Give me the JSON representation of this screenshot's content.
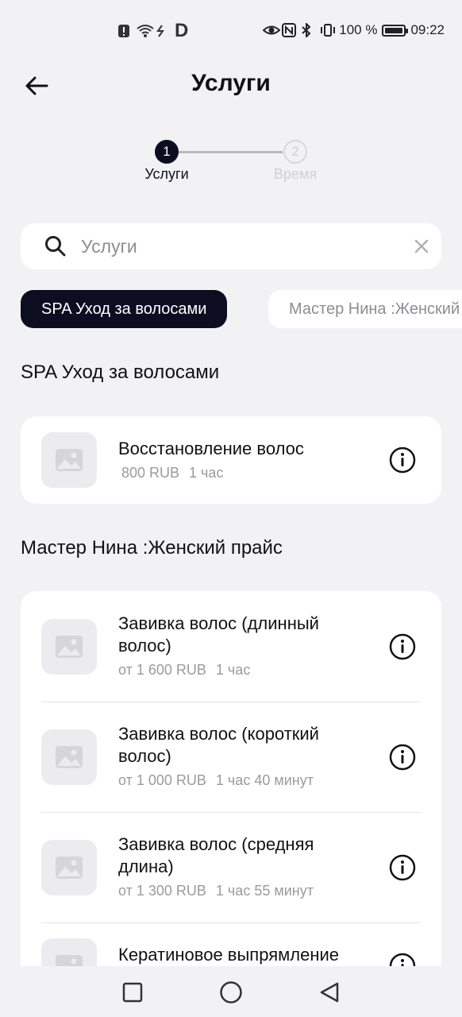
{
  "status_bar": {
    "carrier_glyph": "D",
    "battery": "100 %",
    "time": "09:22"
  },
  "header": {
    "title": "Услуги"
  },
  "stepper": {
    "steps": [
      {
        "number": "1",
        "label": "Услуги"
      },
      {
        "number": "2",
        "label": "Время"
      }
    ]
  },
  "search": {
    "placeholder": "Услуги",
    "value": ""
  },
  "chips": [
    {
      "label": "SPA Уход за волосами"
    },
    {
      "label": "Мастер Нина :Женский прайс"
    }
  ],
  "sections": [
    {
      "title": "SPA Уход за волосами",
      "services": [
        {
          "name": "Восстановление волос",
          "price": "800 RUB",
          "duration": "1 час"
        }
      ]
    },
    {
      "title": "Мастер Нина :Женский прайс",
      "services": [
        {
          "name": "Завивка волос (длинный волос)",
          "price": "от 1 600 RUB",
          "duration": "1 час"
        },
        {
          "name": "Завивка волос (короткий волос)",
          "price": "от 1 000 RUB",
          "duration": "1 час 40 минут"
        },
        {
          "name": "Завивка волос (средняя длина)",
          "price": "от 1 300 RUB",
          "duration": "1 час 55 минут"
        },
        {
          "name": "Кератиновое выпрямление",
          "price": "",
          "duration": ""
        }
      ]
    }
  ],
  "colors": {
    "background": "#f2f2f4",
    "accent": "#0d0d22",
    "muted_text": "#8d8d93"
  }
}
